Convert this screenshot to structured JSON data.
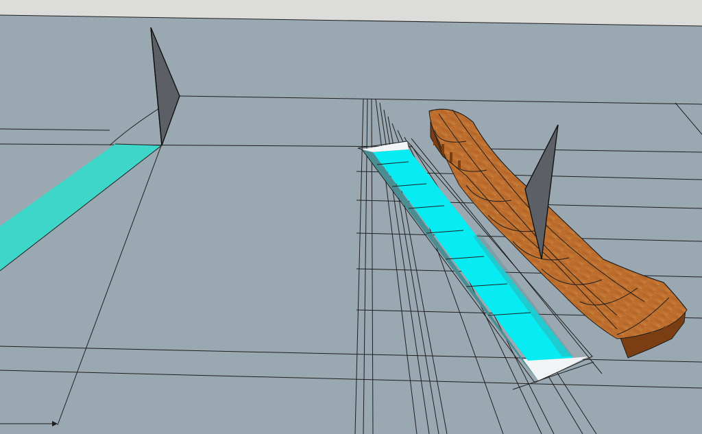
{
  "app": {
    "kind": "3D modeling viewport"
  },
  "scene": {
    "colors": {
      "sky": "#dcdcda",
      "ground": "#9aa8b1",
      "cyan_left": "#3ed6c8",
      "cyan_right": "#07ecf2",
      "cyan_shadow": "#4a8e93",
      "white_face": "#f2f4f6",
      "wood": "#b96a2c",
      "wood_dark": "#7a3e12",
      "sail": "#5c6066",
      "line": "#1e1e1e"
    },
    "objects": [
      "left-cyan-strip",
      "left-sail-blade",
      "right-cyan-strip",
      "wooden-ramp",
      "right-sail-blade",
      "axis-arrow"
    ]
  }
}
